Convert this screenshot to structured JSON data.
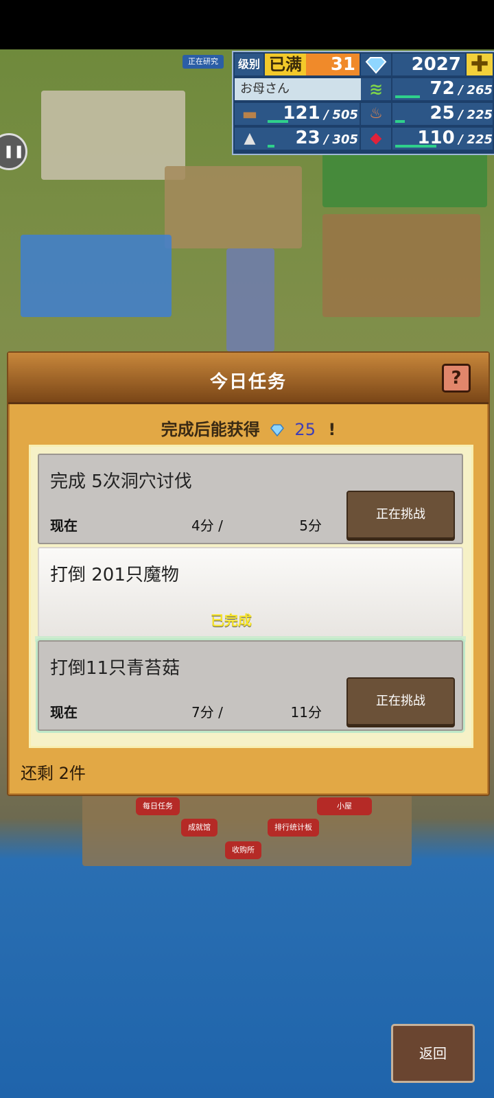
{
  "hud": {
    "research_tag": "正在研究",
    "level_label": "级别",
    "level_status": "已满",
    "level_value": "31",
    "gems": "2027",
    "plus_icon": "plus-icon",
    "player_name": "お母さん",
    "resources": [
      {
        "icon": "grass-icon",
        "current": "72",
        "max": "265",
        "ratio": 0.27
      },
      {
        "icon": "wood-icon",
        "current": "121",
        "max": "505",
        "ratio": 0.24
      },
      {
        "icon": "food-icon",
        "current": "25",
        "max": "225",
        "ratio": 0.11
      },
      {
        "icon": "ore-icon",
        "current": "23",
        "max": "305",
        "ratio": 0.08
      },
      {
        "icon": "ruby-icon",
        "current": "110",
        "max": "225",
        "ratio": 0.49
      }
    ],
    "separator": "/"
  },
  "panel": {
    "title": "今日任务",
    "help_symbol": "?",
    "reward_prefix": "完成后能获得",
    "reward_amount": "25",
    "reward_suffix": "!",
    "remaining": "还剩 2件"
  },
  "tasks": [
    {
      "title": "完成 5次洞穴讨伐",
      "progress_label": "现在",
      "current": "4分 /",
      "target": "5分",
      "button": "正在挑战"
    },
    {
      "title": "打倒 201只魔物",
      "status": "已完成"
    },
    {
      "title": "打倒11只青苔菇",
      "progress_label": "现在",
      "current": "7分 /",
      "target": "11分",
      "button": "正在挑战"
    }
  ],
  "map_labels": {
    "daily": "每日任务",
    "hut": "小屋",
    "achievement": "成就馆",
    "ranking": "排行统计板",
    "buy": "收购所"
  },
  "back_button": "返回"
}
